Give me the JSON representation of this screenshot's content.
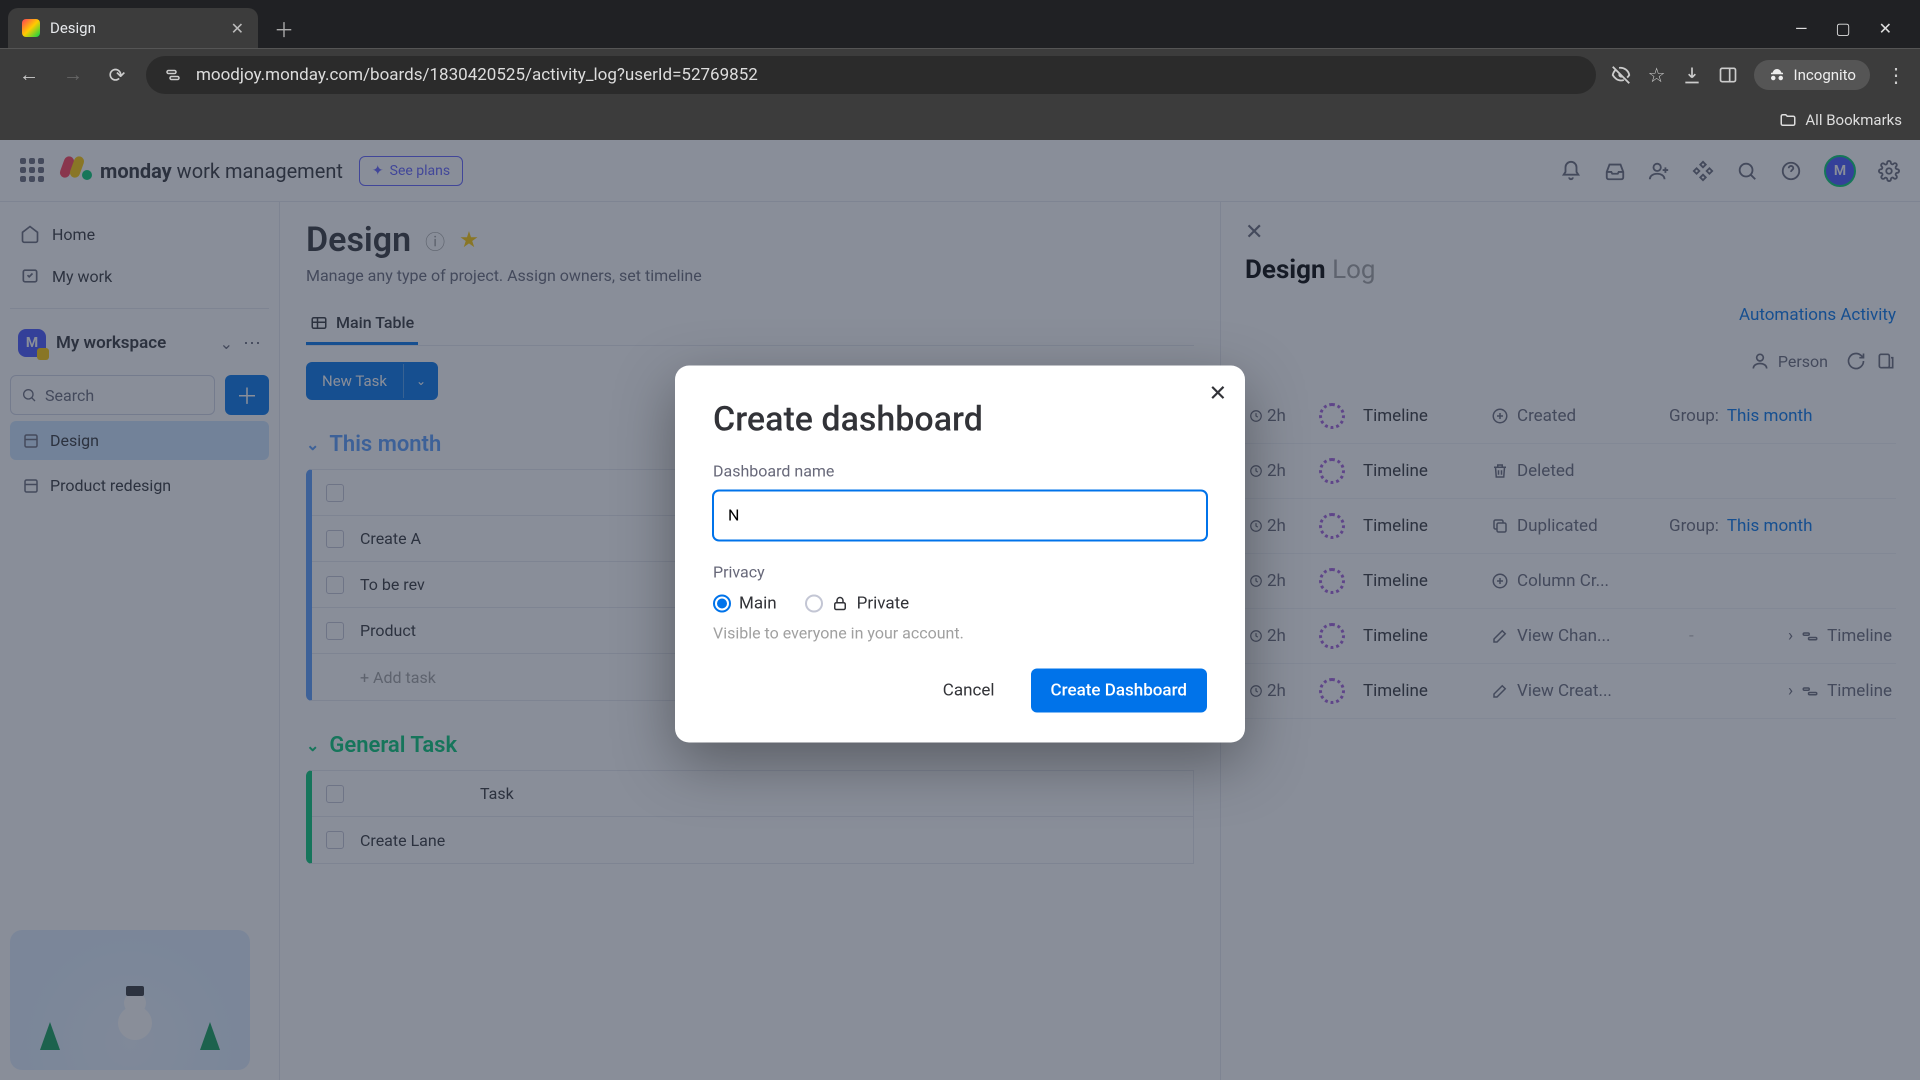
{
  "browser": {
    "tab_title": "Design",
    "url": "moodjoy.monday.com/boards/1830420525/activity_log?userId=52769852",
    "incognito_label": "Incognito",
    "all_bookmarks": "All Bookmarks"
  },
  "topbar": {
    "brand_bold": "monday",
    "brand_rest": " work management",
    "see_plans": "See plans"
  },
  "sidebar": {
    "home": "Home",
    "mywork": "My work",
    "workspace": "My workspace",
    "search_placeholder": "Search",
    "boards": [
      "Design",
      "Product redesign"
    ]
  },
  "board": {
    "title": "Design",
    "subtitle": "Manage any type of project. Assign owners, set timeline",
    "tab_main": "Main Table",
    "new_task": "New Task",
    "group_month": "This month",
    "group_general": "General Task",
    "task_header": "Task",
    "rows_month": [
      "Create A",
      "To be rev",
      "Product "
    ],
    "add_task": "+ Add task",
    "rows_general": [
      "Create Lane"
    ]
  },
  "log": {
    "title_main": "Design",
    "title_sub": "Log",
    "automations": "Automations Activity",
    "filter_person": "Person",
    "entries": [
      {
        "time": "2h",
        "name": "Timeline",
        "action": "Created",
        "action_icon": "plus",
        "group": "This month"
      },
      {
        "time": "2h",
        "name": "Timeline",
        "action": "Deleted",
        "action_icon": "trash",
        "group": ""
      },
      {
        "time": "2h",
        "name": "Timeline",
        "action": "Duplicated",
        "action_icon": "copy",
        "group": "This month"
      },
      {
        "time": "2h",
        "name": "Timeline",
        "action": "Column Cr...",
        "action_icon": "plus",
        "group": ""
      },
      {
        "time": "2h",
        "name": "Timeline",
        "action": "View Chan...",
        "action_icon": "pencil",
        "tl": "Timeline",
        "dash": "-"
      },
      {
        "time": "2h",
        "name": "Timeline",
        "action": "View Creat...",
        "action_icon": "pencil",
        "tl": "Timeline"
      }
    ],
    "group_label": "Group:"
  },
  "modal": {
    "title": "Create dashboard",
    "name_label": "Dashboard name",
    "name_value": "N",
    "privacy_label": "Privacy",
    "opt_main": "Main",
    "opt_private": "Private",
    "hint": "Visible to everyone in your account.",
    "cancel": "Cancel",
    "create": "Create Dashboard"
  }
}
